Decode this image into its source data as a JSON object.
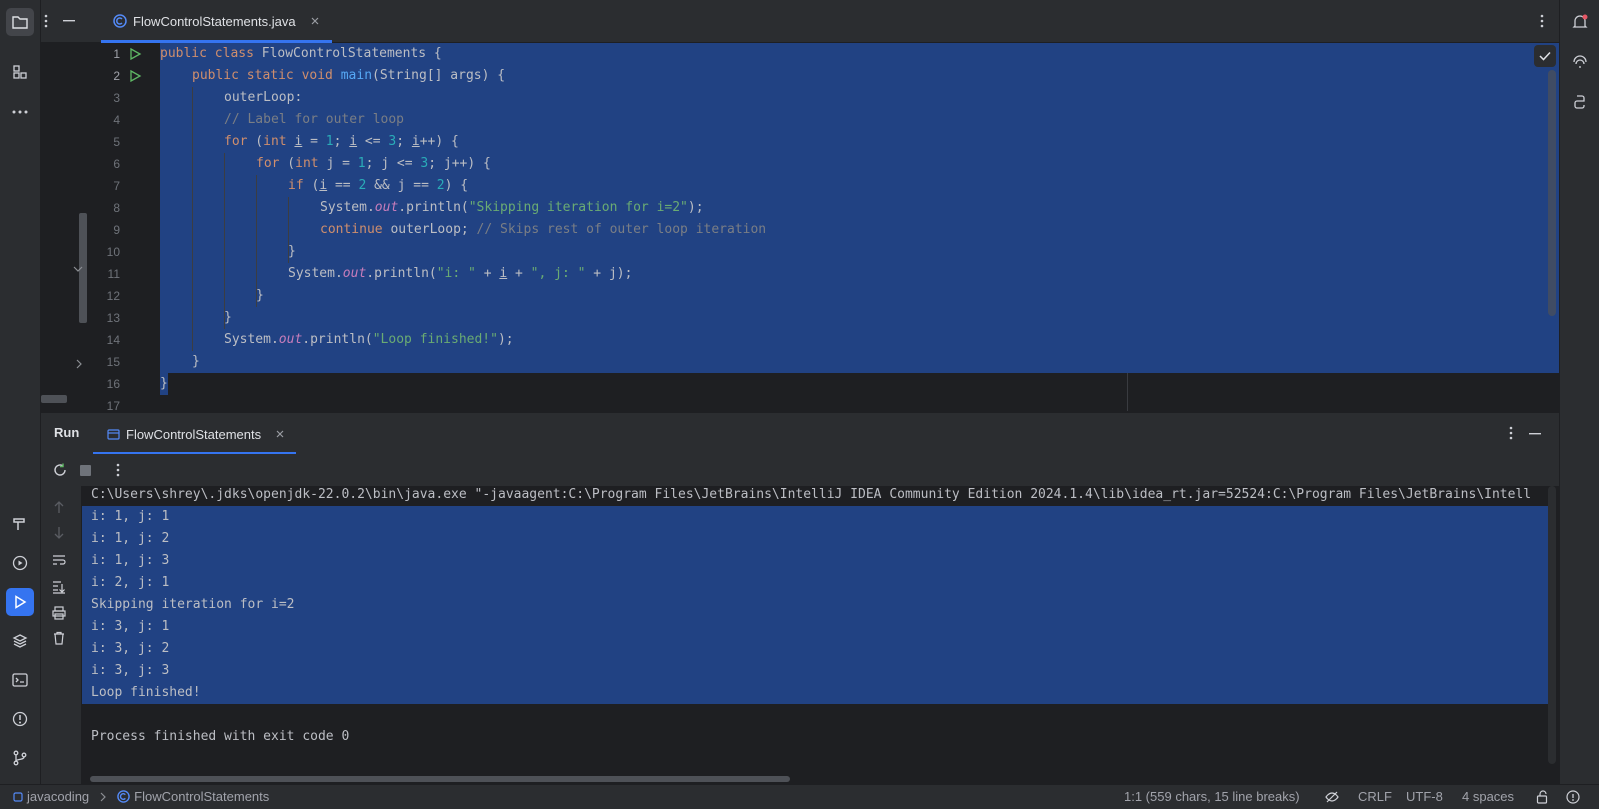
{
  "editor": {
    "tab_label": "FlowControlStatements.java",
    "line_numbers": [
      "1",
      "2",
      "3",
      "4",
      "5",
      "6",
      "7",
      "8",
      "9",
      "10",
      "11",
      "12",
      "13",
      "14",
      "15",
      "16",
      "17"
    ],
    "code": {
      "l1_kw": "public class ",
      "l1_rest": "FlowControlStatements {",
      "l2_kw": "public static void ",
      "l2_fn": "main",
      "l2_rest": "(String[] args) {",
      "l3": "outerLoop:",
      "l4": "// Label for outer loop",
      "l5_for": "for",
      "l5_p1": " (",
      "l5_int": "int",
      "l5_sp": " ",
      "l5_i": "i",
      "l5_eq": " = ",
      "l5_1": "1",
      "l5_semi": "; ",
      "l5_i2": "i",
      "l5_le": " <= ",
      "l5_3": "3",
      "l5_semi2": "; ",
      "l5_i3": "i",
      "l5_end": "++) {",
      "l6_for": "for",
      "l6_p1": " (",
      "l6_int": "int",
      "l6_j": " j = ",
      "l6_1": "1",
      "l6_semi": "; j <= ",
      "l6_3": "3",
      "l6_end": "; j++) {",
      "l7_if": "if",
      "l7_p": " (",
      "l7_i": "i",
      "l7_eq": " == ",
      "l7_2": "2",
      "l7_and": " && ",
      "l7_j": "j",
      "l7_eq2": " == ",
      "l7_2b": "2",
      "l7_end": ") {",
      "l8_sys": "System.",
      "l8_out": "out",
      "l8_pr": ".println(",
      "l8_str": "\"Skipping iteration for i=2\"",
      "l8_end": ");",
      "l9_kw": "continue",
      "l9_rest": " outerLoop; ",
      "l9_cmt": "// Skips rest of outer loop iteration",
      "l10": "}",
      "l11_sys": "System.",
      "l11_out": "out",
      "l11_pr": ".println(",
      "l11_s1": "\"i: \"",
      "l11_plus": " + ",
      "l11_i": "i",
      "l11_plus2": " + ",
      "l11_s2": "\", j: \"",
      "l11_end": " + j);",
      "l12": "}",
      "l13": "}",
      "l14_sys": "System.",
      "l14_out": "out",
      "l14_pr": ".println(",
      "l14_str": "\"Loop finished!\"",
      "l14_end": ");",
      "l15": "}",
      "l16": "}"
    }
  },
  "run_panel": {
    "title": "Run",
    "tab_label": "FlowControlStatements",
    "command": "C:\\Users\\shrey\\.jdks\\openjdk-22.0.2\\bin\\java.exe \"-javaagent:C:\\Program Files\\JetBrains\\IntelliJ IDEA Community Edition 2024.1.4\\lib\\idea_rt.jar=52524:C:\\Program Files\\JetBrains\\Intell",
    "output": [
      "i: 1, j: 1",
      "i: 1, j: 2",
      "i: 1, j: 3",
      "i: 2, j: 1",
      "Skipping iteration for i=2",
      "i: 3, j: 1",
      "i: 3, j: 2",
      "i: 3, j: 3",
      "Loop finished!"
    ],
    "exit_message": "Process finished with exit code 0"
  },
  "status_bar": {
    "project": "javacoding",
    "file": "FlowControlStatements",
    "position": "1:1 (559 chars, 15 line breaks)",
    "line_separator": "CRLF",
    "encoding": "UTF-8",
    "indent": "4 spaces"
  },
  "colors": {
    "accent": "#3574f0",
    "selection": "#214283",
    "keyword": "#cf8e6d",
    "string": "#6aab73",
    "number": "#2aacb8",
    "function": "#56a8f5"
  }
}
